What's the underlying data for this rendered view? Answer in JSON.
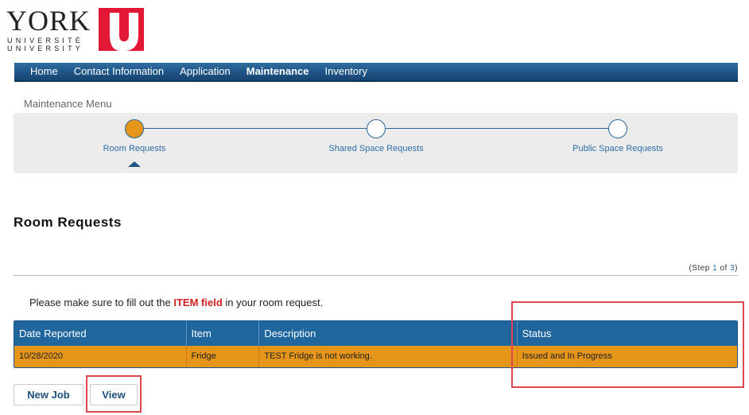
{
  "logo": {
    "word": "YORK",
    "line1": "UNIVERSITÉ",
    "line2": "UNIVERSITY",
    "mark": "U",
    "brand_color": "#e31837"
  },
  "nav": {
    "items": [
      {
        "label": "Home"
      },
      {
        "label": "Contact Information"
      },
      {
        "label": "Application"
      },
      {
        "label": "Maintenance",
        "active": true
      },
      {
        "label": "Inventory"
      }
    ]
  },
  "menu_label": "Maintenance Menu",
  "steps": [
    {
      "label": "Room Requests",
      "current": true
    },
    {
      "label": "Shared Space Requests"
    },
    {
      "label": "Public Space Requests"
    }
  ],
  "page_title": "Room Requests",
  "step_count": {
    "prefix": "(Step ",
    "current": "1",
    "middle": " of ",
    "total": "3",
    "suffix": ")"
  },
  "notice": {
    "before": "Please make sure to fill out the ",
    "highlight": "ITEM field",
    "after": " in your room request."
  },
  "table": {
    "headers": [
      "Date Reported",
      "Item",
      "Description",
      "Status"
    ],
    "rows": [
      [
        "10/28/2020",
        "Fridge",
        "TEST Fridge is not working.",
        "Issued and In Progress"
      ]
    ]
  },
  "buttons": {
    "new_job": "New Job",
    "view": "View"
  },
  "colors": {
    "nav_blue": "#1f5586",
    "row_orange": "#e5951a",
    "highlight_red": "#e0474c",
    "current_step": "#e5951a"
  }
}
